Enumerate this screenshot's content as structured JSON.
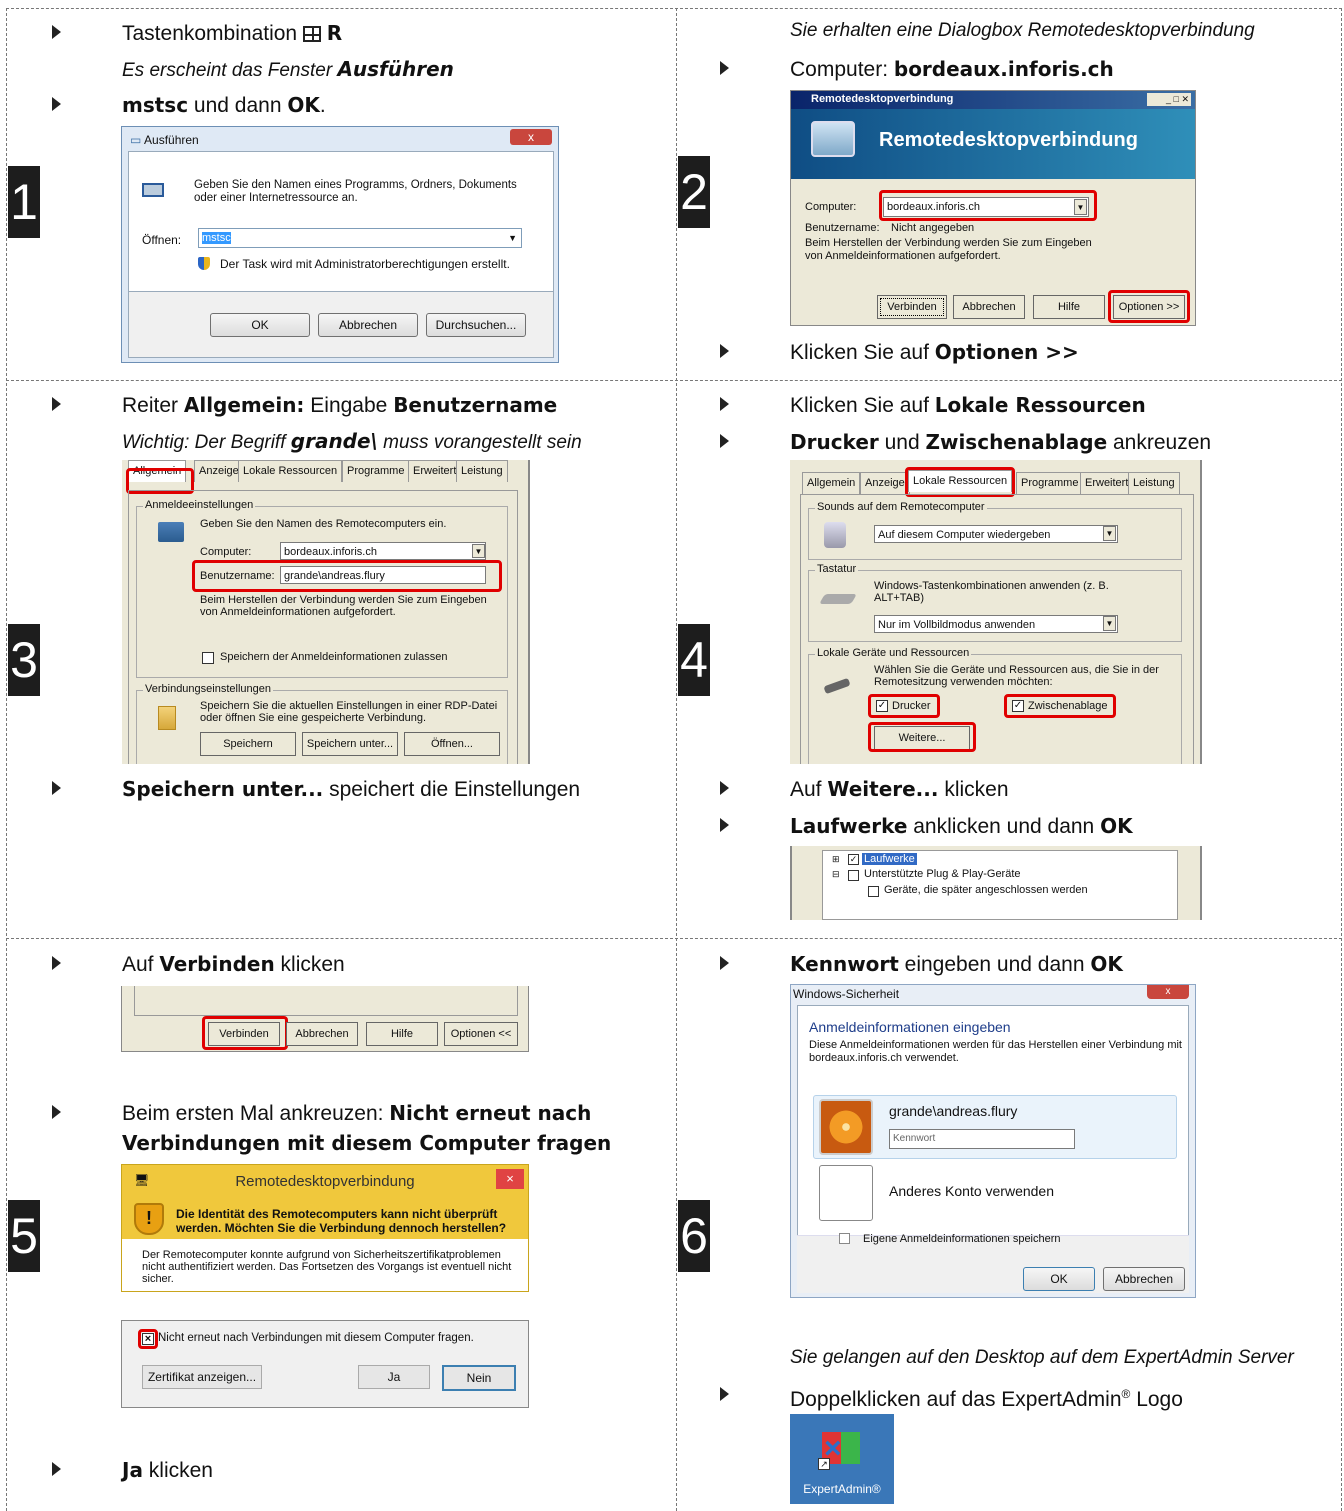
{
  "steps": {
    "n1": "1",
    "n2": "2",
    "n3": "3",
    "n4": "4",
    "n5": "5",
    "n6": "6"
  },
  "s1": {
    "l1_pre": "Tastenkombination",
    "l1_key": "R",
    "l2_pre": "Es erscheint das Fenster ",
    "l2_bold": "Ausführen",
    "l3_b1": "mstsc",
    "l3_mid": " und dann ",
    "l3_b2": "OK",
    "l3_end": ".",
    "dlg": {
      "title": "Ausführen",
      "desc": "Geben Sie den Namen eines Programms, Ordners, Dokuments oder einer Internetressource an.",
      "open_label": "Öffnen:",
      "open_value": "mstsc",
      "admin": "Der Task wird mit Administratorberechtigungen erstellt.",
      "ok": "OK",
      "cancel": "Abbrechen",
      "browse": "Durchsuchen..."
    }
  },
  "s2": {
    "l1": "Sie erhalten eine Dialogbox Remotedesktopverbindung",
    "l2_pre": "Computer: ",
    "l2_bold": "bordeaux.inforis.ch",
    "l3_pre": "Klicken Sie auf ",
    "l3_bold": "Optionen >>",
    "dlg": {
      "title": "Remotedesktopverbindung",
      "banner": "Remotedesktopverbindung",
      "computer_label": "Computer:",
      "computer_value": "bordeaux.inforis.ch",
      "user_label": "Benutzername:",
      "user_value": "Nicht angegeben",
      "info": "Beim Herstellen der Verbindung werden Sie zum Eingeben von Anmeldeinformationen aufgefordert.",
      "connect": "Verbinden",
      "cancel": "Abbrechen",
      "help": "Hilfe",
      "options": "Optionen >>"
    }
  },
  "s3": {
    "l1_pre": "Reiter ",
    "l1_b1": "Allgemein:",
    "l1_mid": " Eingabe ",
    "l1_b2": "Benutzername",
    "l2_pre": "Wichtig: Der Begriff ",
    "l2_bold": "grande\\",
    "l2_end": " muss vorangestellt sein",
    "l3_bold": "Speichern unter...",
    "l3_end": " speichert die Einstellungen",
    "dlg": {
      "tabs": [
        "Allgemein",
        "Anzeige",
        "Lokale Ressourcen",
        "Programme",
        "Erweitert",
        "Leistung"
      ],
      "grp1": "Anmeldeeinstellungen",
      "desc": "Geben Sie den Namen des Remotecomputers ein.",
      "computer_label": "Computer:",
      "computer_value": "bordeaux.inforis.ch",
      "user_label": "Benutzername:",
      "user_value": "grande\\andreas.flury",
      "info": "Beim Herstellen der Verbindung werden Sie zum Eingeben von Anmeldeinformationen aufgefordert.",
      "save_creds": "Speichern der Anmeldeinformationen zulassen",
      "grp2": "Verbindungseinstellungen",
      "conn_desc": "Speichern Sie die aktuellen Einstellungen in einer RDP-Datei oder öffnen Sie eine gespeicherte Verbindung.",
      "save": "Speichern",
      "save_as": "Speichern unter...",
      "open": "Öffnen..."
    }
  },
  "s4": {
    "l1_pre": "Klicken Sie auf ",
    "l1_bold": "Lokale Ressourcen",
    "l2_b1": "Drucker",
    "l2_mid": " und ",
    "l2_b2": "Zwischenablage",
    "l2_end": " ankreuzen",
    "l3_pre": "Auf ",
    "l3_bold": "Weitere...",
    "l3_end": " klicken",
    "l4_bold": "Laufwerke",
    "l4_mid": " anklicken und dann ",
    "l4_b2": "OK",
    "dlg": {
      "tabs": [
        "Allgemein",
        "Anzeige",
        "Lokale Ressourcen",
        "Programme",
        "Erweitert",
        "Leistung"
      ],
      "grp_sound": "Sounds auf dem Remotecomputer",
      "sound_value": "Auf diesem Computer wiedergeben",
      "grp_kbd": "Tastatur",
      "kbd_desc": "Windows-Tastenkombinationen anwenden (z. B. ALT+TAB)",
      "kbd_value": "Nur im Vollbildmodus anwenden",
      "grp_dev": "Lokale Geräte und Ressourcen",
      "dev_desc": "Wählen Sie die Geräte und Ressourcen aus, die Sie in der Remotesitzung verwenden möchten:",
      "printer": "Drucker",
      "clipboard": "Zwischenablage",
      "more": "Weitere..."
    },
    "tree": {
      "item1": "Laufwerke",
      "item2": "Unterstützte Plug & Play-Geräte",
      "item3": "Geräte, die später angeschlossen werden"
    }
  },
  "s5": {
    "l1_pre": "Auf ",
    "l1_bold": "Verbinden",
    "l1_end": " klicken",
    "l2_pre": "Beim ersten Mal ankreuzen: ",
    "l2_bold1": "Nicht erneut nach",
    "l2_bold2": "Verbindungen mit diesem Computer fragen",
    "l3_bold": "Ja",
    "l3_end": " klicken",
    "bar": {
      "connect": "Verbinden",
      "cancel": "Abbrechen",
      "help": "Hilfe",
      "options": "Optionen <<"
    },
    "warn": {
      "title": "Remotedesktopverbindung",
      "headline": "Die Identität des Remotecomputers kann nicht überprüft werden. Möchten Sie die Verbindung dennoch herstellen?",
      "body": "Der Remotecomputer konnte aufgrund von Sicherheitszertifikatproblemen nicht authentifiziert werden. Das Fortsetzen des Vorgangs ist eventuell nicht sicher.",
      "checkbox": "Nicht erneut nach Verbindungen mit diesem Computer fragen.",
      "cert": "Zertifikat anzeigen...",
      "yes": "Ja",
      "no": "Nein"
    }
  },
  "s6": {
    "l1_bold": "Kennwort",
    "l1_mid": " eingeben und dann ",
    "l1_b2": "OK",
    "l2": "Sie gelangen auf den Desktop auf dem ExpertAdmin Server",
    "l3_pre": "Doppelklicken auf das ExpertAdmin",
    "l3_sup": "®",
    "l3_end": " Logo",
    "dlg": {
      "title": "Windows-Sicherheit",
      "heading": "Anmeldeinformationen eingeben",
      "desc": "Diese Anmeldeinformationen werden für das Herstellen einer Verbindung mit bordeaux.inforis.ch verwendet.",
      "user": "grande\\andreas.flury",
      "pw_placeholder": "Kennwort",
      "other": "Anderes Konto verwenden",
      "remember": "Eigene Anmeldeinformationen speichern",
      "ok": "OK",
      "cancel": "Abbrechen"
    },
    "logo_label": "ExpertAdmin®"
  }
}
